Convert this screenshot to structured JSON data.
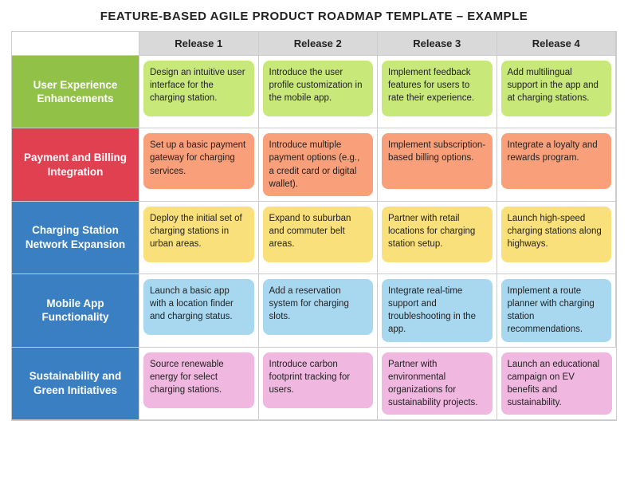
{
  "title": "FEATURE-BASED AGILE PRODUCT ROADMAP TEMPLATE – EXAMPLE",
  "columns": [
    "Release 1",
    "Release 2",
    "Release 3",
    "Release 4"
  ],
  "rows": [
    {
      "label": "User Experience Enhancements",
      "color_class": "ux",
      "card_class": "card-ux",
      "cells": [
        "Design an intuitive user interface for the charging station.",
        "Introduce the user profile customization in the mobile app.",
        "Implement feedback features for users to rate their experience.",
        "Add multilingual support in the app and at charging stations."
      ]
    },
    {
      "label": "Payment and Billing Integration",
      "color_class": "payment",
      "card_class": "card-payment",
      "cells": [
        "Set up a basic payment gateway for charging services.",
        "Introduce multiple payment options (e.g., a credit card or digital wallet).",
        "Implement subscription-based billing options.",
        "Integrate a loyalty and rewards program."
      ]
    },
    {
      "label": "Charging Station Network Expansion",
      "color_class": "charging",
      "card_class": "card-charging",
      "cells": [
        "Deploy the initial set of charging stations in urban areas.",
        "Expand to suburban and commuter belt areas.",
        "Partner with retail locations for charging station setup.",
        "Launch high-speed charging stations along highways."
      ]
    },
    {
      "label": "Mobile App Functionality",
      "color_class": "mobile",
      "card_class": "card-mobile",
      "cells": [
        "Launch a basic app with a location finder and charging status.",
        "Add a reservation system for charging slots.",
        "Integrate real-time support and troubleshooting in the app.",
        "Implement a route planner with charging station recommendations."
      ]
    },
    {
      "label": "Sustainability and Green Initiatives",
      "color_class": "sustain",
      "card_class": "card-sustain",
      "cells": [
        "Source renewable energy for select charging stations.",
        "Introduce carbon footprint tracking for users.",
        "Partner with environmental organizations for sustainability projects.",
        "Launch an educational campaign on EV benefits and sustainability."
      ]
    }
  ]
}
